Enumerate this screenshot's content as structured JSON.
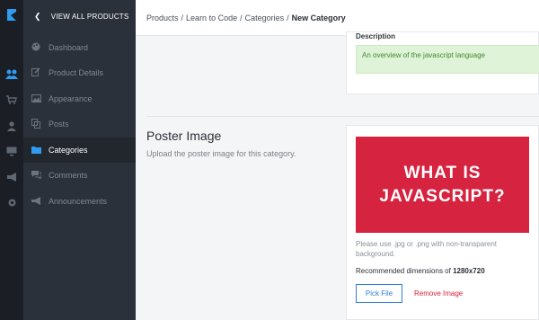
{
  "sidebar": {
    "back_label": "VIEW ALL PRODUCTS",
    "items": [
      {
        "label": "Dashboard",
        "icon": "palette-icon"
      },
      {
        "label": "Product Details",
        "icon": "edit-icon"
      },
      {
        "label": "Appearance",
        "icon": "image-icon"
      },
      {
        "label": "Posts",
        "icon": "copy-icon"
      },
      {
        "label": "Categories",
        "icon": "folder-icon"
      },
      {
        "label": "Comments",
        "icon": "comments-icon"
      },
      {
        "label": "Announcements",
        "icon": "megaphone-icon"
      }
    ]
  },
  "breadcrumb": {
    "items": [
      "Products",
      "Learn to Code",
      "Categories"
    ],
    "current": "New Category",
    "separator": "/"
  },
  "description": {
    "label": "Description",
    "value": "An overview of the javascript language"
  },
  "poster": {
    "title": "Poster Image",
    "subtitle": "Upload the poster image for this category.",
    "image_line1": "WHAT IS",
    "image_line2": "JAVASCRIPT?",
    "hint": "Please use .jpg or .png with non-transparent background.",
    "dims_prefix": "Recommended dimensions of",
    "dims_value": "1280x720",
    "pick_label": "Pick File",
    "remove_label": "Remove Image"
  },
  "colors": {
    "accent": "#2f9cf0",
    "poster_bg": "#d6233f",
    "success_bg": "#dff3d8",
    "danger": "#d6233f"
  }
}
